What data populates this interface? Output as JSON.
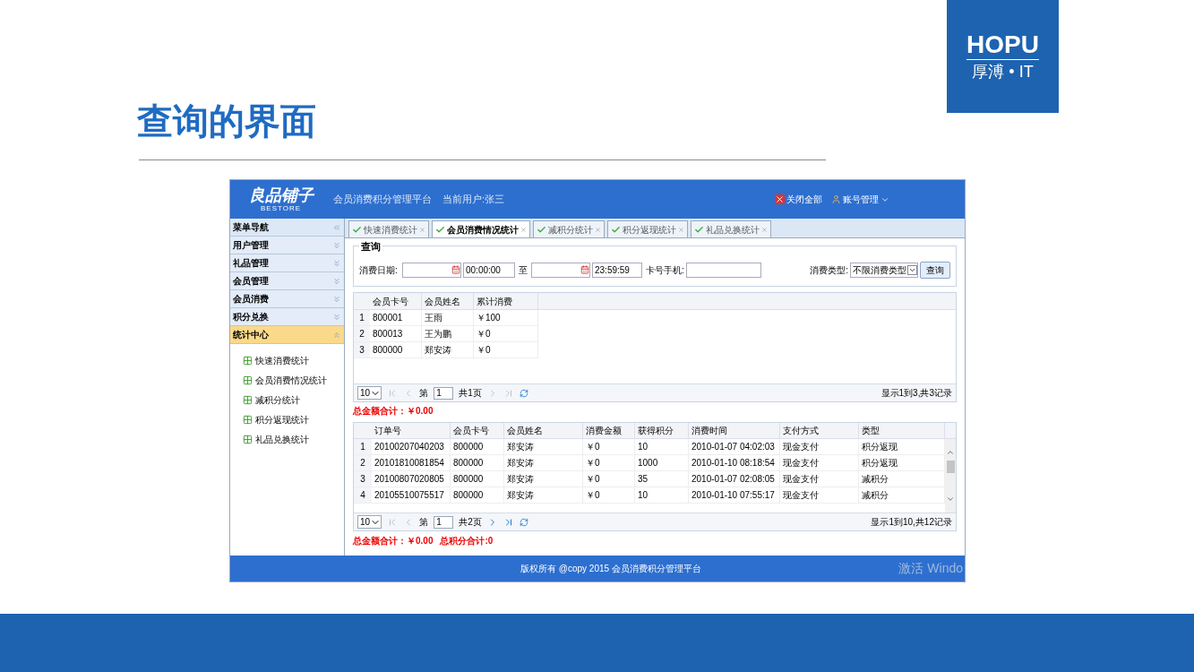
{
  "slide": {
    "title": "查询的界面",
    "logo": {
      "brand": "HOPU",
      "sub": "厚溥 • IT"
    }
  },
  "app": {
    "logo": {
      "name": "良品铺子",
      "sub": "BESTORE"
    },
    "platform": "会员消费积分管理平台",
    "current_user": "当前用户:张三",
    "actions": [
      {
        "kind": "close",
        "label": "关闭全部"
      },
      {
        "kind": "account",
        "label": "账号管理"
      }
    ],
    "sidebar": {
      "title": "菜单导航",
      "groups": [
        {
          "label": "用户管理",
          "expanded": false
        },
        {
          "label": "礼品管理",
          "expanded": false
        },
        {
          "label": "会员管理",
          "expanded": false
        },
        {
          "label": "会员消费",
          "expanded": false
        },
        {
          "label": "积分兑换",
          "expanded": false
        },
        {
          "label": "统计中心",
          "expanded": true,
          "children": [
            "快速消费统计",
            "会员消费情况统计",
            "减积分统计",
            "积分返现统计",
            "礼品兑换统计"
          ]
        }
      ]
    },
    "tabs": [
      {
        "label": "快速消费统计",
        "selected": false
      },
      {
        "label": "会员消费情况统计",
        "selected": true
      },
      {
        "label": "减积分统计",
        "selected": false
      },
      {
        "label": "积分返现统计",
        "selected": false
      },
      {
        "label": "礼品兑换统计",
        "selected": false
      }
    ],
    "query": {
      "legend": "查询",
      "date_label": "消费日期:",
      "start_time": "00:00:00",
      "to": "至",
      "end_time": "23:59:59",
      "card_label": "卡号手机:",
      "type_label": "消费类型:",
      "type_value": "不限消费类型",
      "button": "查询"
    },
    "table1": {
      "columns": [
        "",
        "会员卡号",
        "会员姓名",
        "累计消费"
      ],
      "rows": [
        [
          "1",
          "800001",
          "王雨",
          "￥100"
        ],
        [
          "2",
          "800013",
          "王为鹏",
          "￥0"
        ],
        [
          "3",
          "800000",
          "郑安涛",
          "￥0"
        ]
      ],
      "pager": {
        "page_size": "10",
        "page_prefix": "第",
        "page": "1",
        "total_pages": "共1页",
        "summary": "显示1到3,共3记录",
        "next_disabled": true
      },
      "total": "总金额合计：￥0.00"
    },
    "table2": {
      "columns": [
        "",
        "订单号",
        "会员卡号",
        "会员姓名",
        "消费金额",
        "获得积分",
        "消费时间",
        "支付方式",
        "类型"
      ],
      "rows": [
        [
          "1",
          "20100207040203",
          "800000",
          "郑安涛",
          "￥0",
          "10",
          "2010-01-07 04:02:03",
          "现金支付",
          "积分返现"
        ],
        [
          "2",
          "20101810081854",
          "800000",
          "郑安涛",
          "￥0",
          "1000",
          "2010-01-10 08:18:54",
          "现金支付",
          "积分返现"
        ],
        [
          "3",
          "20100807020805",
          "800000",
          "郑安涛",
          "￥0",
          "35",
          "2010-01-07 02:08:05",
          "现金支付",
          "减积分"
        ],
        [
          "4",
          "20105510075517",
          "800000",
          "郑安涛",
          "￥0",
          "10",
          "2010-01-10 07:55:17",
          "现金支付",
          "减积分"
        ]
      ],
      "pager": {
        "page_size": "10",
        "page_prefix": "第",
        "page": "1",
        "total_pages": "共2页",
        "summary": "显示1到10,共12记录",
        "next_disabled": false
      },
      "totals": [
        "总金额合计：￥0.00",
        "总积分合计:0"
      ]
    },
    "footer": "版权所有 @copy 2015 会员消费积分管理平台",
    "watermark": "激活 Windo"
  }
}
